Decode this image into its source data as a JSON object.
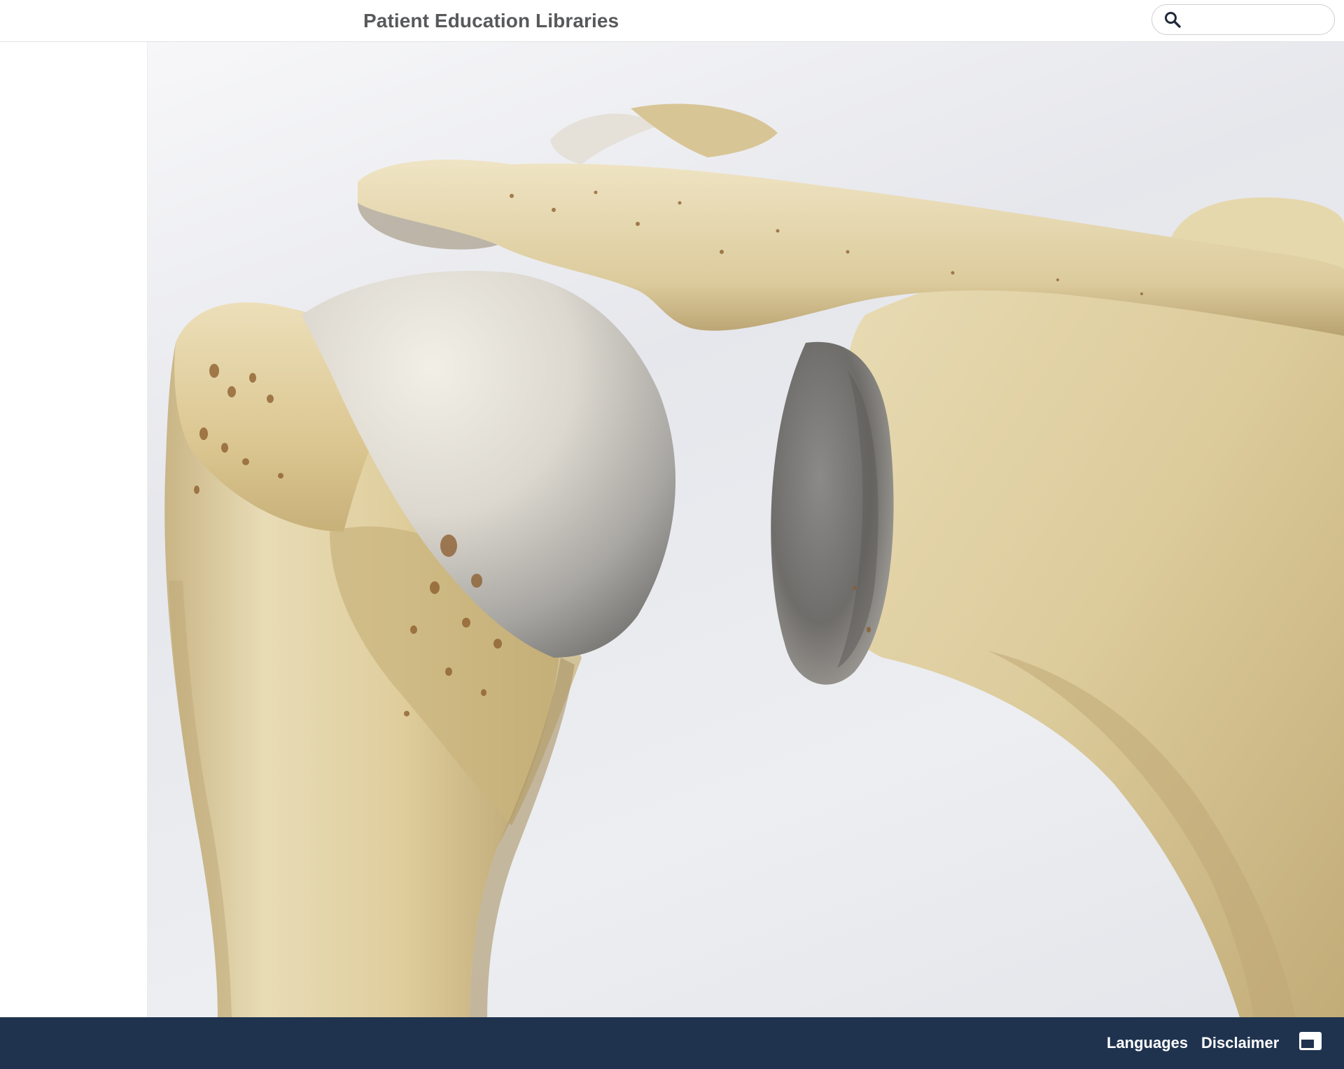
{
  "header": {
    "title": "Patient Education Libraries",
    "search": {
      "placeholder": "",
      "value": "",
      "icon": "search-icon"
    }
  },
  "viewer": {
    "image": "shoulder-joint-bone-illustration"
  },
  "footer": {
    "links": [
      {
        "label": "Languages"
      },
      {
        "label": "Disclaimer"
      }
    ],
    "layout_toggle_icon": "panel-layout-icon"
  },
  "colors": {
    "header_title": "#58595b",
    "footer_bg": "#1f334f",
    "footer_text": "#ffffff",
    "bone": "#e2d3a8",
    "cartilage": "#d9d7d2"
  }
}
